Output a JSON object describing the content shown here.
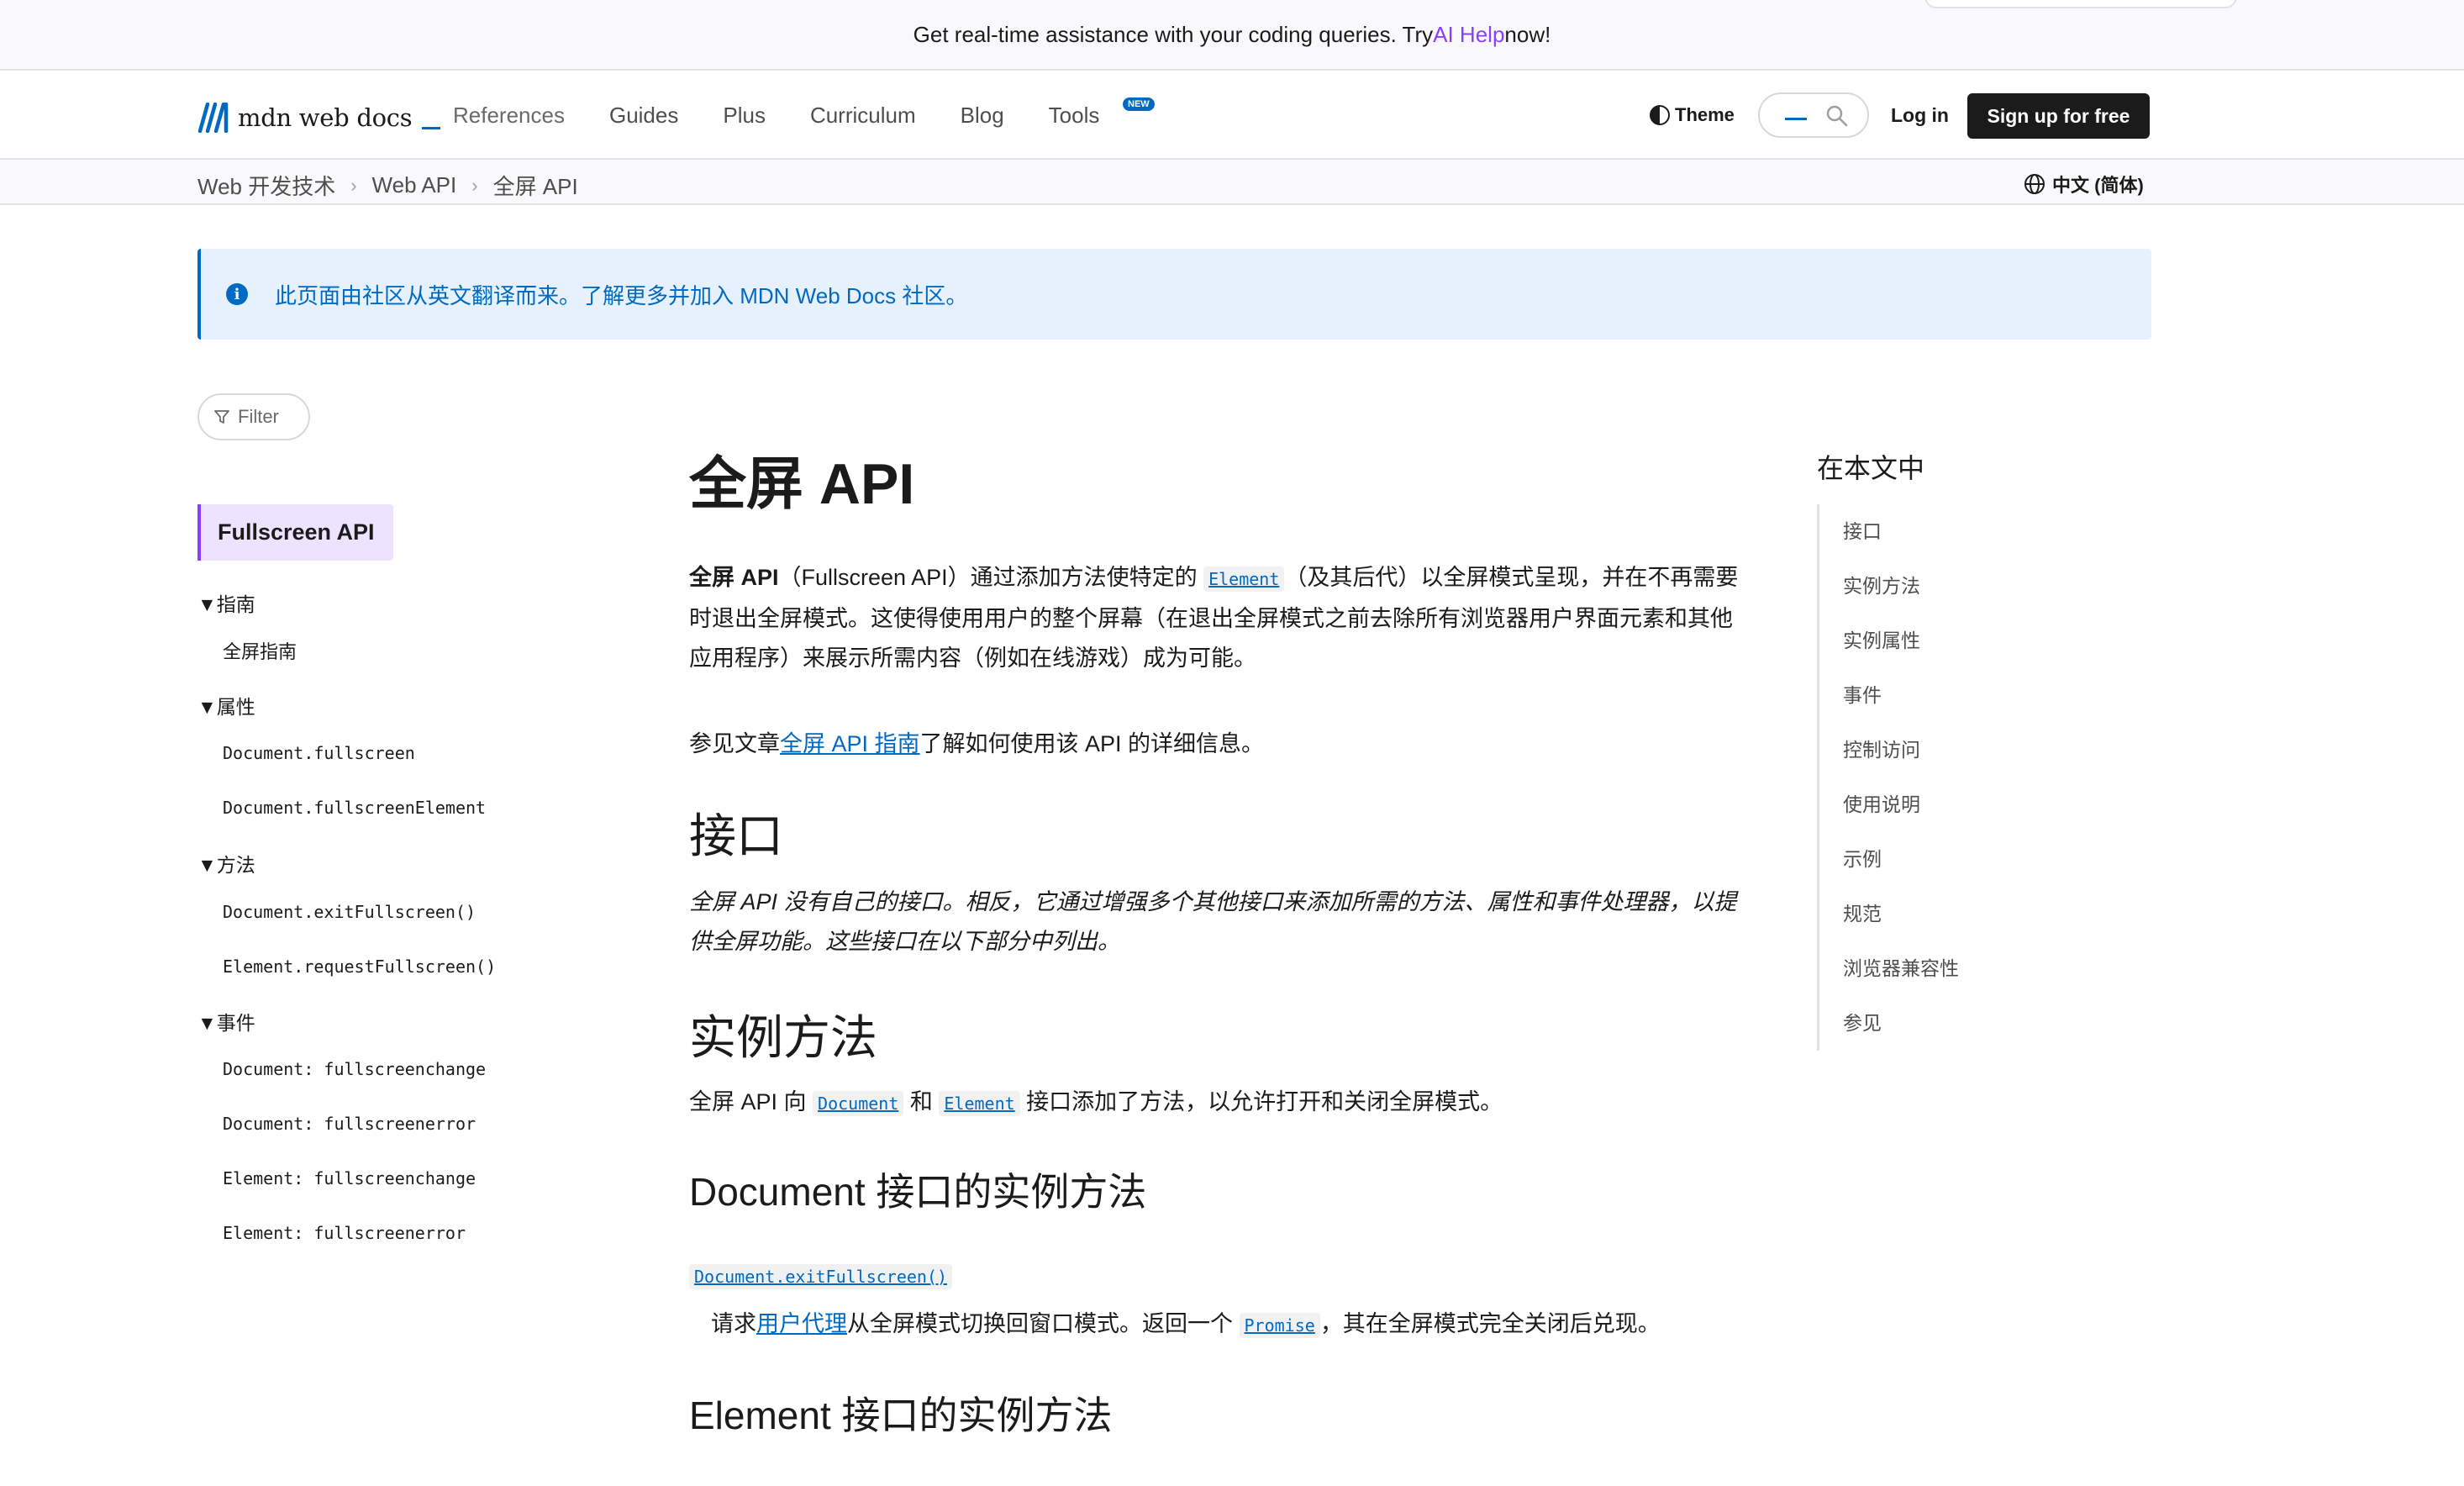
{
  "banner": {
    "prefix": "Get real-time assistance with your coding queries. Try ",
    "link": "AI Help",
    "suffix": " now!"
  },
  "header": {
    "logo_text": "mdn web docs",
    "nav": [
      "References",
      "Guides",
      "Plus",
      "Curriculum",
      "Blog",
      "Tools"
    ],
    "tools_badge": "NEW",
    "theme_label": "Theme",
    "login_label": "Log in",
    "signup_label": "Sign up for free"
  },
  "breadcrumbs": [
    "Web 开发技术",
    "Web API",
    "全屏 API"
  ],
  "language": "中文 (简体)",
  "notice": "此页面由社区从英文翻译而来。了解更多并加入 MDN Web Docs 社区。",
  "sidebar": {
    "filter_label": "Filter",
    "current": "Fullscreen API",
    "groups": [
      {
        "label": "▼指南",
        "items": [
          "全屏指南"
        ]
      },
      {
        "label": "▼属性",
        "items": [
          "Document.fullscreen",
          "Document.fullscreenElement"
        ]
      },
      {
        "label": "▼方法",
        "items": [
          "Document.exitFullscreen()",
          "Element.requestFullscreen()"
        ]
      },
      {
        "label": "▼事件",
        "items": [
          "Document: fullscreenchange",
          "Document: fullscreenerror",
          "Element: fullscreenchange",
          "Element: fullscreenerror"
        ]
      }
    ]
  },
  "article": {
    "title": "全屏 API",
    "intro": {
      "bold": "全屏 API",
      "t1": "（Fullscreen API）通过添加方法使特定的 ",
      "code1": "Element",
      "t2": "（及其后代）以全屏模式呈现，并在不再需要时退出全屏模式。这使得使用用户的整个屏幕（在退出全屏模式之前去除所有浏览器用户界面元素和其他应用程序）来展示所需内容（例如在线游戏）成为可能。"
    },
    "see_also": {
      "t1": "参见文章",
      "link": "全屏 API 指南",
      "t2": "了解如何使用该 API 的详细信息。"
    },
    "interfaces_heading": "接口",
    "interfaces_text": "全屏 API 没有自己的接口。相反，它通过增强多个其他接口来添加所需的方法、属性和事件处理器，以提供全屏功能。这些接口在以下部分中列出。",
    "methods_heading": "实例方法",
    "methods_text": {
      "t1": "全屏 API 向 ",
      "code1": "Document",
      "t2": " 和 ",
      "code2": "Element",
      "t3": " 接口添加了方法，以允许打开和关闭全屏模式。"
    },
    "document_methods_heading": "Document 接口的实例方法",
    "exit_code": "Document.exitFullscreen()",
    "exit_desc": {
      "t1": "请求",
      "link": "用户代理",
      "t2": "从全屏模式切换回窗口模式。返回一个 ",
      "code": "Promise",
      "t3": "，其在全屏模式完全关闭后兑现。"
    },
    "element_methods_heading": "Element 接口的实例方法"
  },
  "toc": {
    "title": "在本文中",
    "items": [
      "接口",
      "实例方法",
      "实例属性",
      "事件",
      "控制访问",
      "使用说明",
      "示例",
      "规范",
      "浏览器兼容性",
      "参见"
    ]
  }
}
